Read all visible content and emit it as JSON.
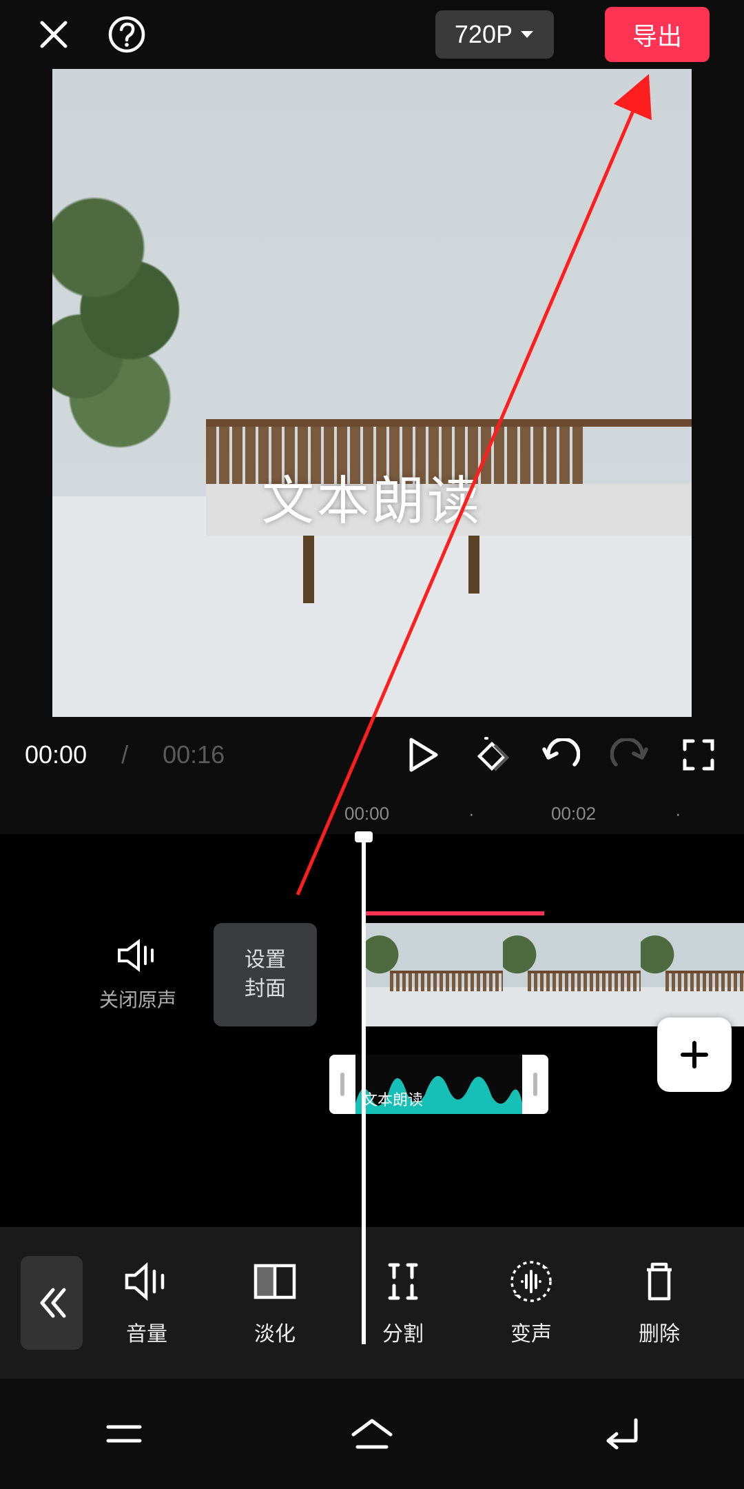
{
  "header": {
    "resolution_label": "720P",
    "export_label": "导出"
  },
  "preview": {
    "text_overlay": "文本朗读"
  },
  "transport": {
    "current_time": "00:00",
    "separator": "/",
    "total_time": "00:16"
  },
  "ruler": {
    "marks": [
      "00:00",
      "·",
      "00:02",
      "·"
    ]
  },
  "timeline": {
    "mute_label": "关闭原声",
    "cover_button": "设置\n封面",
    "audio_clip_label": "文本朗读",
    "plus_label": "+"
  },
  "tools": {
    "volume": "音量",
    "fade": "淡化",
    "split": "分割",
    "voice_change": "变声",
    "delete": "删除"
  },
  "icons": {
    "close": "close",
    "help": "help",
    "chevron_down": "chevron-down",
    "play": "play",
    "keyframe": "keyframe",
    "undo": "undo",
    "redo": "redo",
    "fullscreen": "fullscreen",
    "speaker": "speaker",
    "collapse": "collapse",
    "menu": "menu",
    "home": "home",
    "back": "back"
  },
  "colors": {
    "accent": "#ff3353",
    "wave": "#17c0b6"
  }
}
